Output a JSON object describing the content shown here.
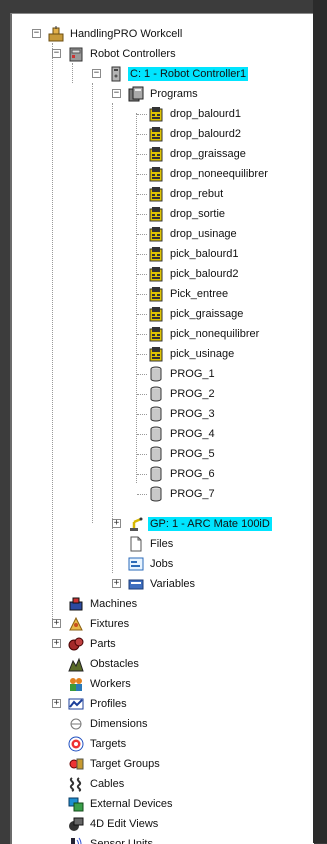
{
  "tree": {
    "root": {
      "label": "HandlingPRO Workcell",
      "icon": "workcell-icon"
    },
    "robot_controllers": {
      "label": "Robot Controllers",
      "icon": "controllers-icon"
    },
    "controller": {
      "label": "C: 1 - Robot Controller1",
      "icon": "controller-icon"
    },
    "programs": {
      "label": "Programs",
      "icon": "programs-folder-icon"
    },
    "program_items": [
      {
        "label": "drop_balourd1",
        "icon": "tp-program-icon"
      },
      {
        "label": "drop_balourd2",
        "icon": "tp-program-icon"
      },
      {
        "label": "drop_graissage",
        "icon": "tp-program-icon"
      },
      {
        "label": "drop_noneequilibrer",
        "icon": "tp-program-icon"
      },
      {
        "label": "drop_rebut",
        "icon": "tp-program-icon"
      },
      {
        "label": "drop_sortie",
        "icon": "tp-program-icon"
      },
      {
        "label": "drop_usinage",
        "icon": "tp-program-icon"
      },
      {
        "label": "pick_balourd1",
        "icon": "tp-program-icon"
      },
      {
        "label": "pick_balourd2",
        "icon": "tp-program-icon"
      },
      {
        "label": "Pick_entree",
        "icon": "tp-program-icon"
      },
      {
        "label": "pick_graissage",
        "icon": "tp-program-icon"
      },
      {
        "label": "pick_nonequilibrer",
        "icon": "tp-program-icon"
      },
      {
        "label": "pick_usinage",
        "icon": "tp-program-icon"
      },
      {
        "label": "PROG_1",
        "icon": "cylinder-program-icon"
      },
      {
        "label": "PROG_2",
        "icon": "cylinder-program-icon"
      },
      {
        "label": "PROG_3",
        "icon": "cylinder-program-icon"
      },
      {
        "label": "PROG_4",
        "icon": "cylinder-program-icon"
      },
      {
        "label": "PROG_5",
        "icon": "cylinder-program-icon"
      },
      {
        "label": "PROG_6",
        "icon": "cylinder-program-icon"
      },
      {
        "label": "PROG_7",
        "icon": "cylinder-program-icon"
      }
    ],
    "robot": {
      "label": "GP: 1 - ARC Mate 100iD",
      "icon": "robot-arm-icon"
    },
    "files": {
      "label": "Files",
      "icon": "files-icon"
    },
    "jobs": {
      "label": "Jobs",
      "icon": "jobs-icon"
    },
    "variables": {
      "label": "Variables",
      "icon": "variables-icon"
    },
    "top_items": [
      {
        "label": "Machines",
        "icon": "machine-icon",
        "expander": false
      },
      {
        "label": "Fixtures",
        "icon": "fixture-icon",
        "expander": true
      },
      {
        "label": "Parts",
        "icon": "parts-icon",
        "expander": true
      },
      {
        "label": "Obstacles",
        "icon": "obstacle-icon",
        "expander": false
      },
      {
        "label": "Workers",
        "icon": "workers-icon",
        "expander": false
      },
      {
        "label": "Profiles",
        "icon": "profiles-icon",
        "expander": true
      },
      {
        "label": "Dimensions",
        "icon": "dimensions-icon",
        "expander": false
      },
      {
        "label": "Targets",
        "icon": "target-icon",
        "expander": false
      },
      {
        "label": "Target Groups",
        "icon": "target-groups-icon",
        "expander": false
      },
      {
        "label": "Cables",
        "icon": "cable-icon",
        "expander": false
      },
      {
        "label": "External Devices",
        "icon": "external-device-icon",
        "expander": false
      },
      {
        "label": "4D Edit Views",
        "icon": "edit-view-icon",
        "expander": false
      },
      {
        "label": "Sensor Units",
        "icon": "sensor-icon",
        "expander": false
      }
    ],
    "selection_color": "#00e5ff"
  }
}
